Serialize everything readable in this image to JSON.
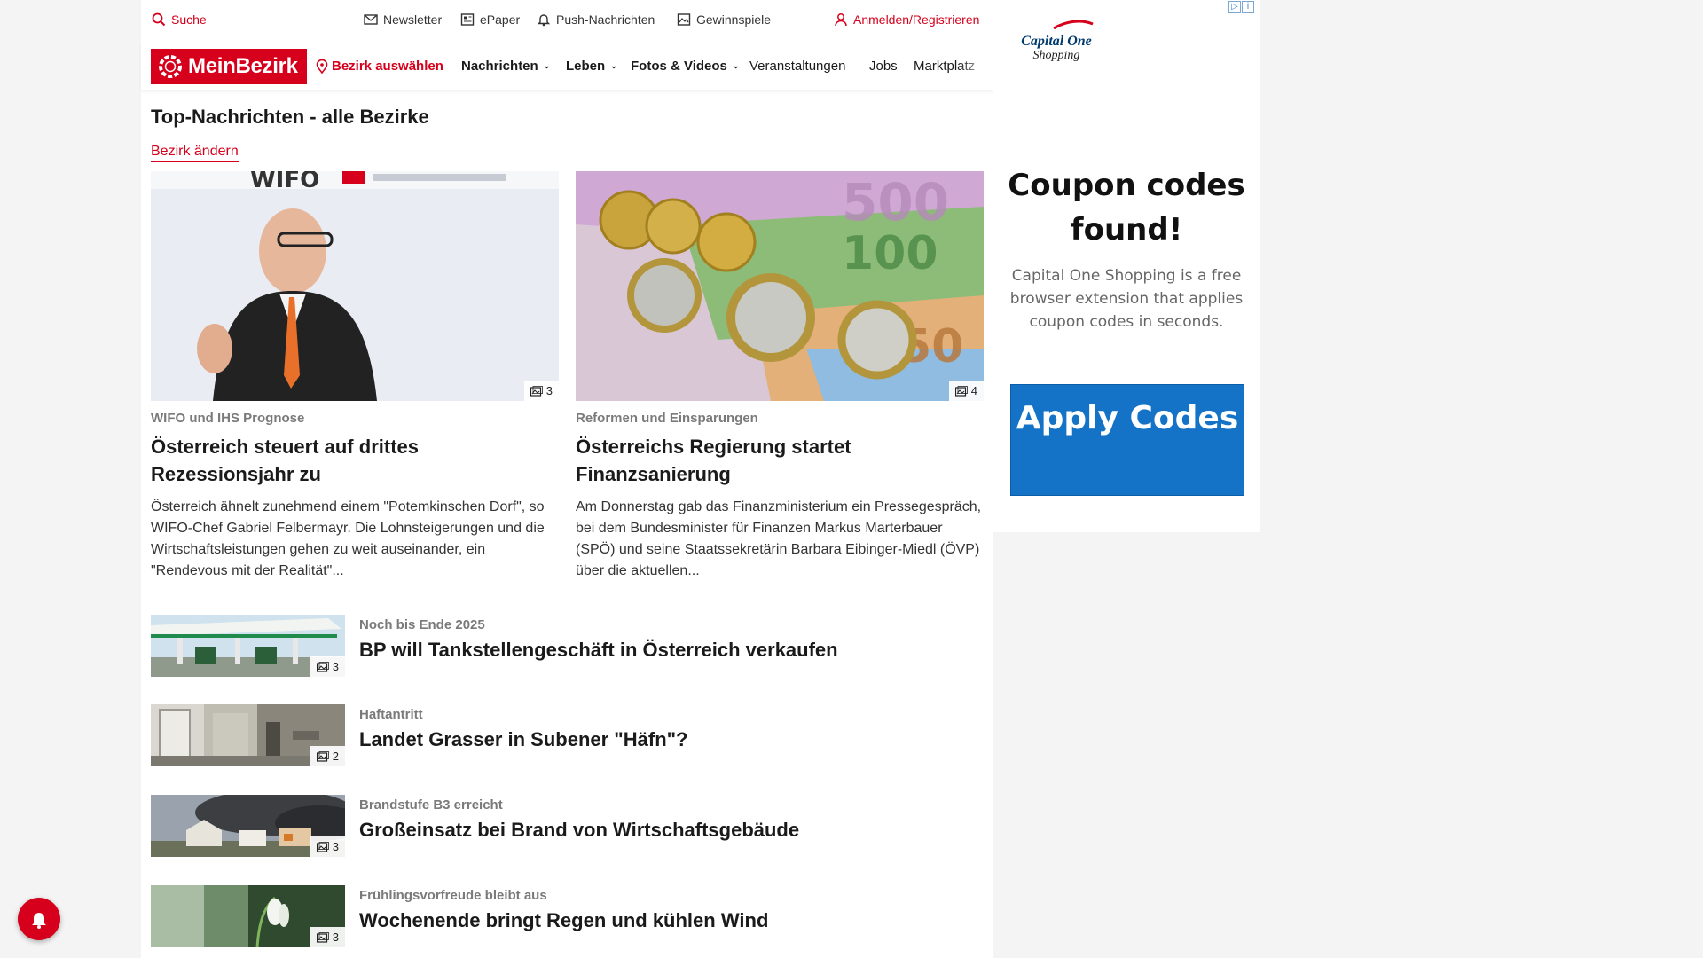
{
  "utility_bar": {
    "search": "Suche",
    "newsletter": "Newsletter",
    "epaper": "ePaper",
    "push": "Push-Nachrichten",
    "games": "Gewinnspiele",
    "login": "Anmelden/Registrieren"
  },
  "nav": {
    "logo": "MeinBezirk",
    "select_district": "Bezirk auswählen",
    "items": [
      "Nachrichten",
      "Leben",
      "Fotos & Videos",
      "Veranstaltungen",
      "Jobs",
      "Marktplatz"
    ]
  },
  "section": {
    "title": "Top-Nachrichten - alle Bezirke",
    "change_link": "Bezirk ändern"
  },
  "cards": [
    {
      "kicker": "WIFO und IHS Prognose",
      "headline": "Österreich steuert auf drittes Rezessionsjahr zu",
      "teaser": "Österreich ähnelt zunehmend einem \"Potemkinschen Dorf\", so WIFO-Chef Gabriel Felbermayr. Die Lohnsteigerungen und die Wirtschaftsleistungen gehen zu weit auseinander, ein \"Rendevous mit der Realität\"...",
      "image_count": "3",
      "image_text": "WIFO"
    },
    {
      "kicker": "Reformen und Einsparungen",
      "headline": "Österreichs Regierung startet Finanzsanierung",
      "teaser": "Am Donnerstag gab das Finanzministerium ein Pressegespräch, bei dem Bundesminister für Finanzen Markus Marterbauer (SPÖ) und seine Staatssekretärin Barbara Eibinger-Miedl (ÖVP) über die aktuellen...",
      "image_count": "4",
      "image_text": "500 100 50"
    }
  ],
  "rows": [
    {
      "kicker": "Noch bis Ende 2025",
      "headline": "BP will Tankstellengeschäft in Österreich verkaufen",
      "image_count": "3"
    },
    {
      "kicker": "Haftantritt",
      "headline": "Landet Grasser in Subener \"Häfn\"?",
      "image_count": "2"
    },
    {
      "kicker": "Brandstufe B3 erreicht",
      "headline": "Großeinsatz bei Brand von Wirtschaftsgebäude",
      "image_count": "3"
    },
    {
      "kicker": "Frühlingsvorfreude bleibt aus",
      "headline": "Wochenende bringt Regen und kühlen Wind",
      "image_count": "3"
    }
  ],
  "ad": {
    "brand": "Capital One",
    "brand_sub": "Shopping",
    "headline": "Coupon codes found!",
    "body": "Capital One Shopping is a free browser extension that applies coupon codes in seconds.",
    "button": "Apply Codes",
    "button_color": "#1473c6"
  },
  "colors": {
    "accent": "#d6001c"
  },
  "icons": [
    "search-icon",
    "mail-icon",
    "newspaper-icon",
    "bell-icon",
    "gift-icon",
    "user-icon",
    "location-pin-icon",
    "gallery-icon",
    "ad-choices-icon"
  ]
}
